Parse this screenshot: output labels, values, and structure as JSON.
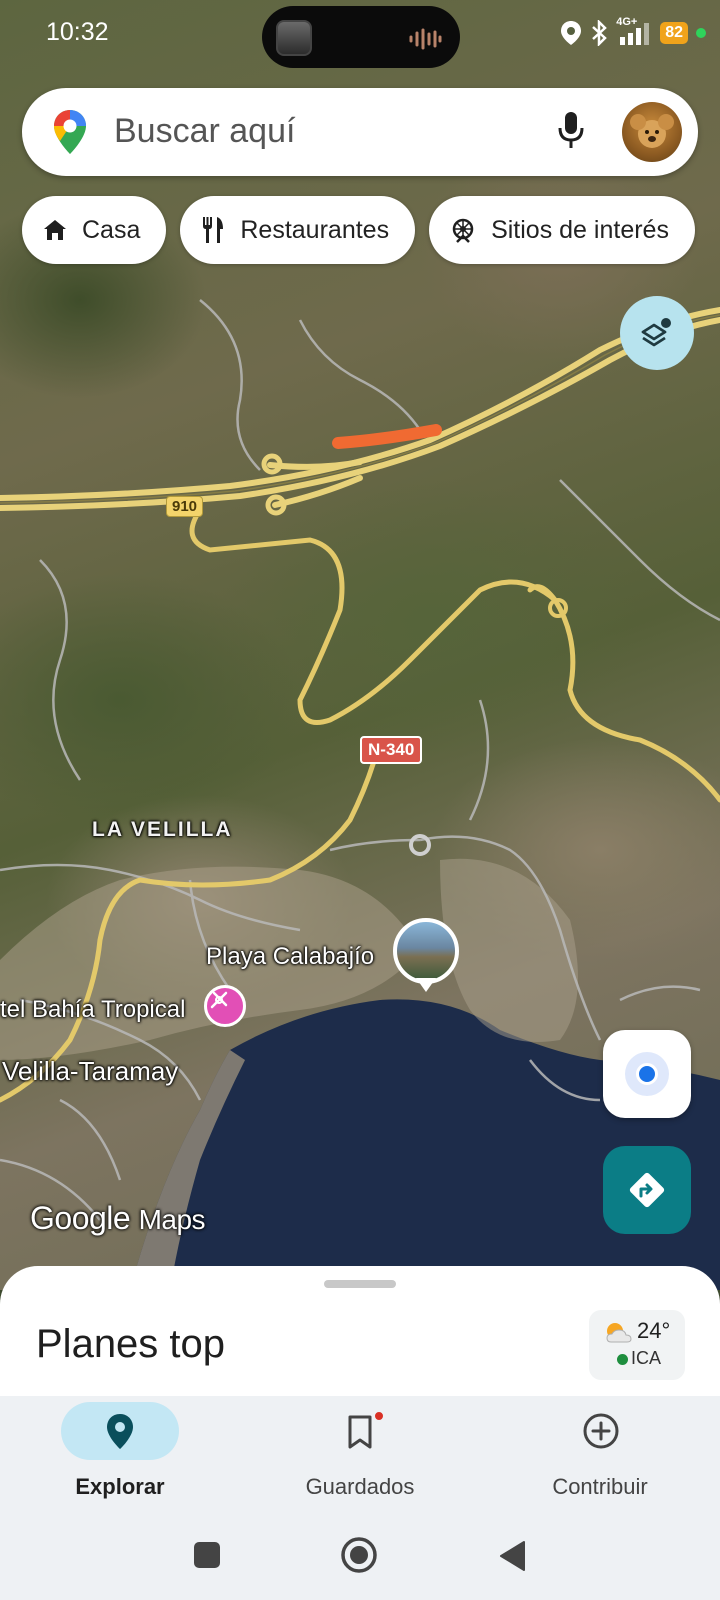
{
  "status_bar": {
    "time": "10:32",
    "network": "4G+",
    "battery": "82"
  },
  "search": {
    "placeholder": "Buscar aquí",
    "icons": [
      "maps-pin-icon",
      "mic-icon",
      "avatar"
    ]
  },
  "chips": [
    {
      "label": "Casa",
      "icon": "home-icon"
    },
    {
      "label": "Restaurantes",
      "icon": "restaurant-icon"
    },
    {
      "label": "Sitios de interés",
      "icon": "attraction-icon"
    }
  ],
  "map": {
    "area_label": "LA VELILLA",
    "road_910": "910",
    "road_n340": "N-340",
    "place_beach": "Playa Calabajío",
    "place_hotel": "tel Bahía Tropical",
    "place_town": "Velilla-Taramay",
    "logo_google": "Google",
    "logo_maps": "Maps"
  },
  "bottom_sheet": {
    "title": "Planes top",
    "weather": {
      "temp": "24°",
      "aqi_label": "ICA"
    }
  },
  "nav": {
    "items": [
      {
        "label": "Explorar",
        "icon": "explore-pin-icon",
        "active": true
      },
      {
        "label": "Guardados",
        "icon": "bookmark-icon",
        "badge": true
      },
      {
        "label": "Contribuir",
        "icon": "add-circle-icon"
      }
    ]
  },
  "colors": {
    "accent_blue": "#1a73e8",
    "directions_teal": "#0b7d86",
    "active_pill": "#c3e7f4",
    "battery": "#f0a31b",
    "hotel_pin": "#e24fb6"
  }
}
